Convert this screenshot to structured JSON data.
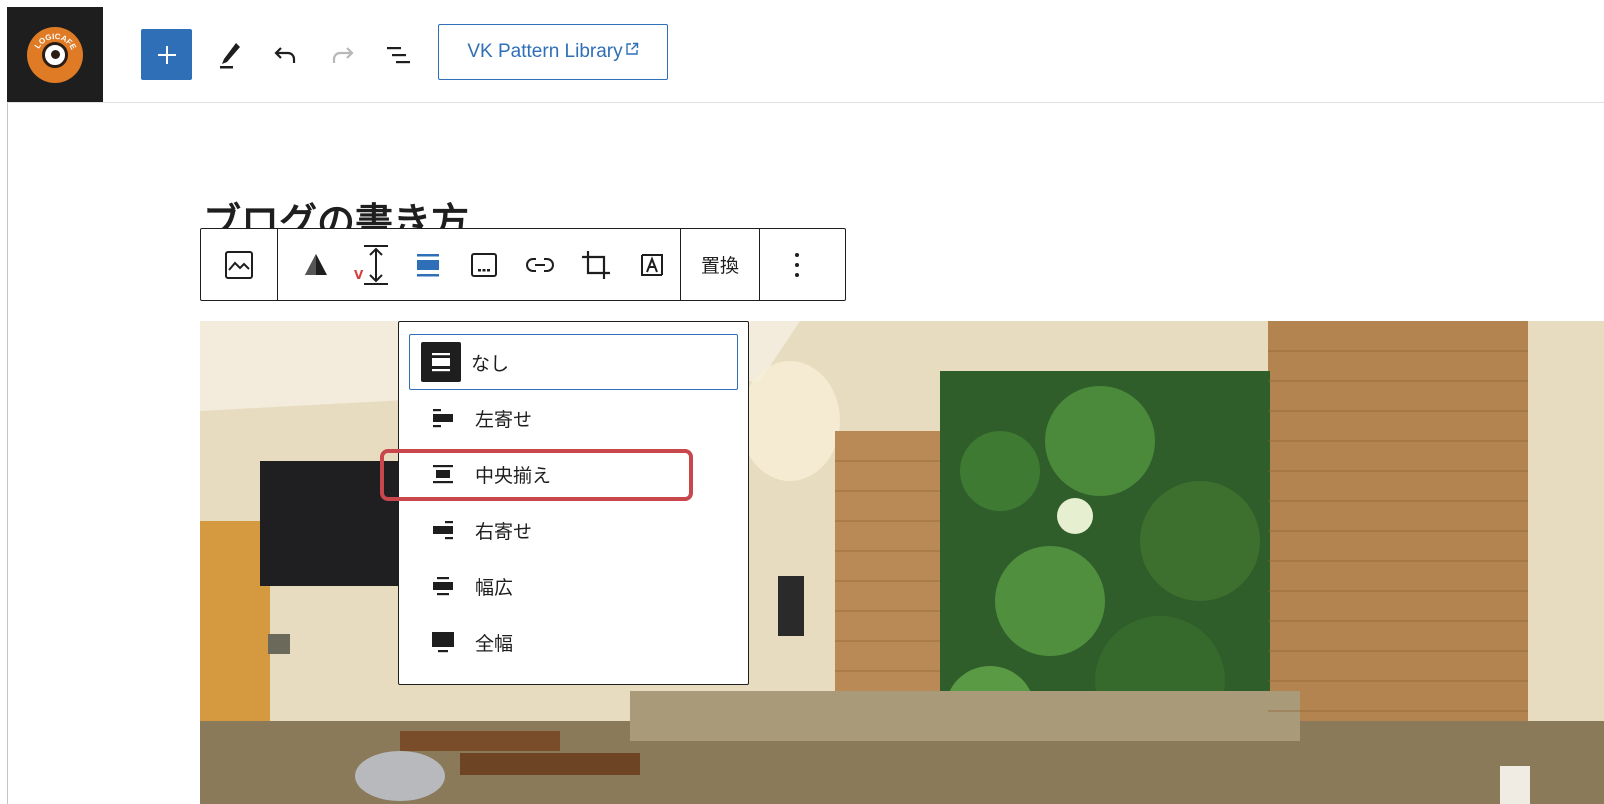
{
  "colors": {
    "accent": "#2f6fb7",
    "highlight_outline": "#c8474c",
    "logo_bg": "#1e1e1e",
    "logo_orange": "#e07b25"
  },
  "header": {
    "logo_text": "LOGICAFE",
    "vk_pattern_label": "VK Pattern Library",
    "icons": [
      "plus-icon",
      "pencil-icon",
      "undo-icon",
      "redo-icon",
      "list-view-icon",
      "external-link-icon"
    ]
  },
  "post": {
    "title": "ブログの書き方"
  },
  "block_toolbar": {
    "replace_label": "置換",
    "icons": [
      "image-icon",
      "triangle-filter-icon",
      "resize-icon",
      "align-center-icon",
      "caption-icon",
      "link-icon",
      "crop-icon",
      "text-overlay-icon",
      "more-options-icon"
    ]
  },
  "align_menu": {
    "items": [
      {
        "label": "なし",
        "icon": "align-none-icon",
        "selected": true
      },
      {
        "label": "左寄せ",
        "icon": "align-left-icon"
      },
      {
        "label": "中央揃え",
        "icon": "align-center-icon",
        "highlighted": true
      },
      {
        "label": "右寄せ",
        "icon": "align-right-icon"
      },
      {
        "label": "幅広",
        "icon": "align-wide-icon"
      },
      {
        "label": "全幅",
        "icon": "align-full-icon"
      }
    ]
  }
}
